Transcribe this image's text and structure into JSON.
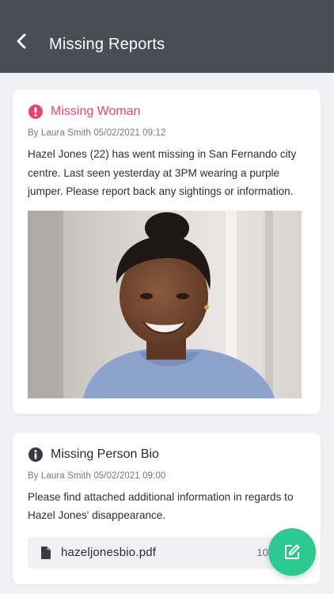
{
  "header": {
    "title": "Missing Reports",
    "back_icon": "chevron-left-icon"
  },
  "colors": {
    "header_bg": "#4a4d55",
    "alert": "#e8436a",
    "fab": "#2bc891",
    "background": "#f1f1f3"
  },
  "posts": [
    {
      "icon": "alert-icon",
      "title": "Missing Woman",
      "byline": "By Laura Smith 05/02/2021  09:12",
      "body": "Hazel Jones (22) has went missing in San Fernando city centre. Last seen yesterday at 3PM wearing a purple jumper. Please report back any sightings or information."
    },
    {
      "icon": "info-icon",
      "title": "Missing Person Bio",
      "byline": "By Laura Smith 05/02/2021  09:00",
      "body": "Please find attached additional information in regards to Hazel Jones' disappearance.",
      "attachment": {
        "icon": "file-icon",
        "name": "hazeljonesbio.pdf",
        "size": "108 KB"
      }
    }
  ],
  "fab": {
    "icon": "edit-icon"
  }
}
